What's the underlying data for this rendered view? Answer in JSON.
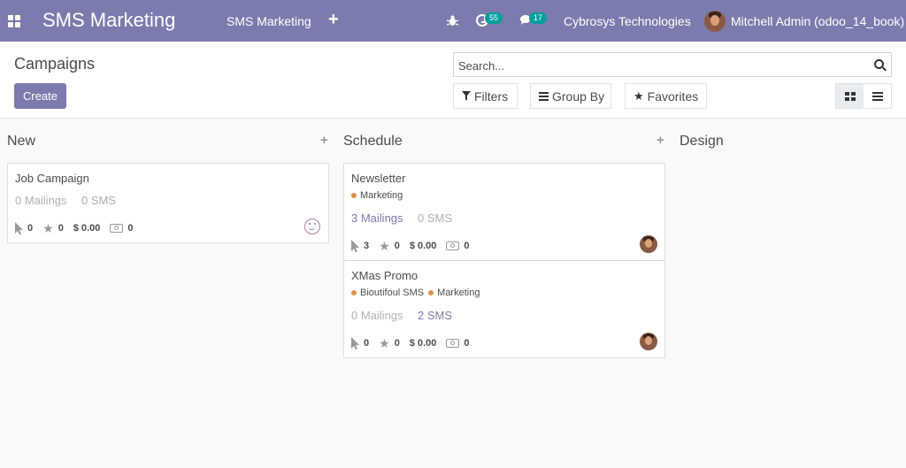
{
  "navbar": {
    "app_title": "SMS Marketing",
    "menu_item": "SMS Marketing",
    "add_symbol": "+",
    "activity_count": "55",
    "messages_count": "17",
    "company": "Cybrosys Technologies",
    "user": "Mitchell Admin (odoo_14_book)",
    "bg_color": "#7c7bad"
  },
  "control_panel": {
    "breadcrumb": "Campaigns",
    "create_label": "Create",
    "search_placeholder": "Search...",
    "filters_label": "Filters",
    "groupby_label": "Group By",
    "favorites_label": "Favorites",
    "active_view": "kanban"
  },
  "columns": [
    {
      "title": "New",
      "cards": [
        {
          "title": "Job Campaign",
          "tags": [],
          "mailings": "0 Mailings",
          "sms": "0 SMS",
          "clicks": "0",
          "stars": "0",
          "revenue": "$ 0.00",
          "cash": "0",
          "owner": "smile-icon"
        }
      ]
    },
    {
      "title": "Schedule",
      "cards": [
        {
          "title": "Newsletter",
          "tags": [
            "Marketing"
          ],
          "mailings": "3 Mailings",
          "sms": "0 SMS",
          "clicks": "3",
          "stars": "0",
          "revenue": "$ 0.00",
          "cash": "0",
          "owner": "avatar"
        },
        {
          "title": "XMas Promo",
          "tags": [
            "Bioutifoul SMS",
            "Marketing"
          ],
          "mailings": "0 Mailings",
          "sms": "2 SMS",
          "clicks": "0",
          "stars": "0",
          "revenue": "$ 0.00",
          "cash": "0",
          "owner": "avatar"
        }
      ]
    },
    {
      "title": "Design",
      "cards": []
    }
  ],
  "colors": {
    "brand": "#7c7bad",
    "tag_dot": "#d9924c",
    "muted": "#b0b0b0"
  }
}
